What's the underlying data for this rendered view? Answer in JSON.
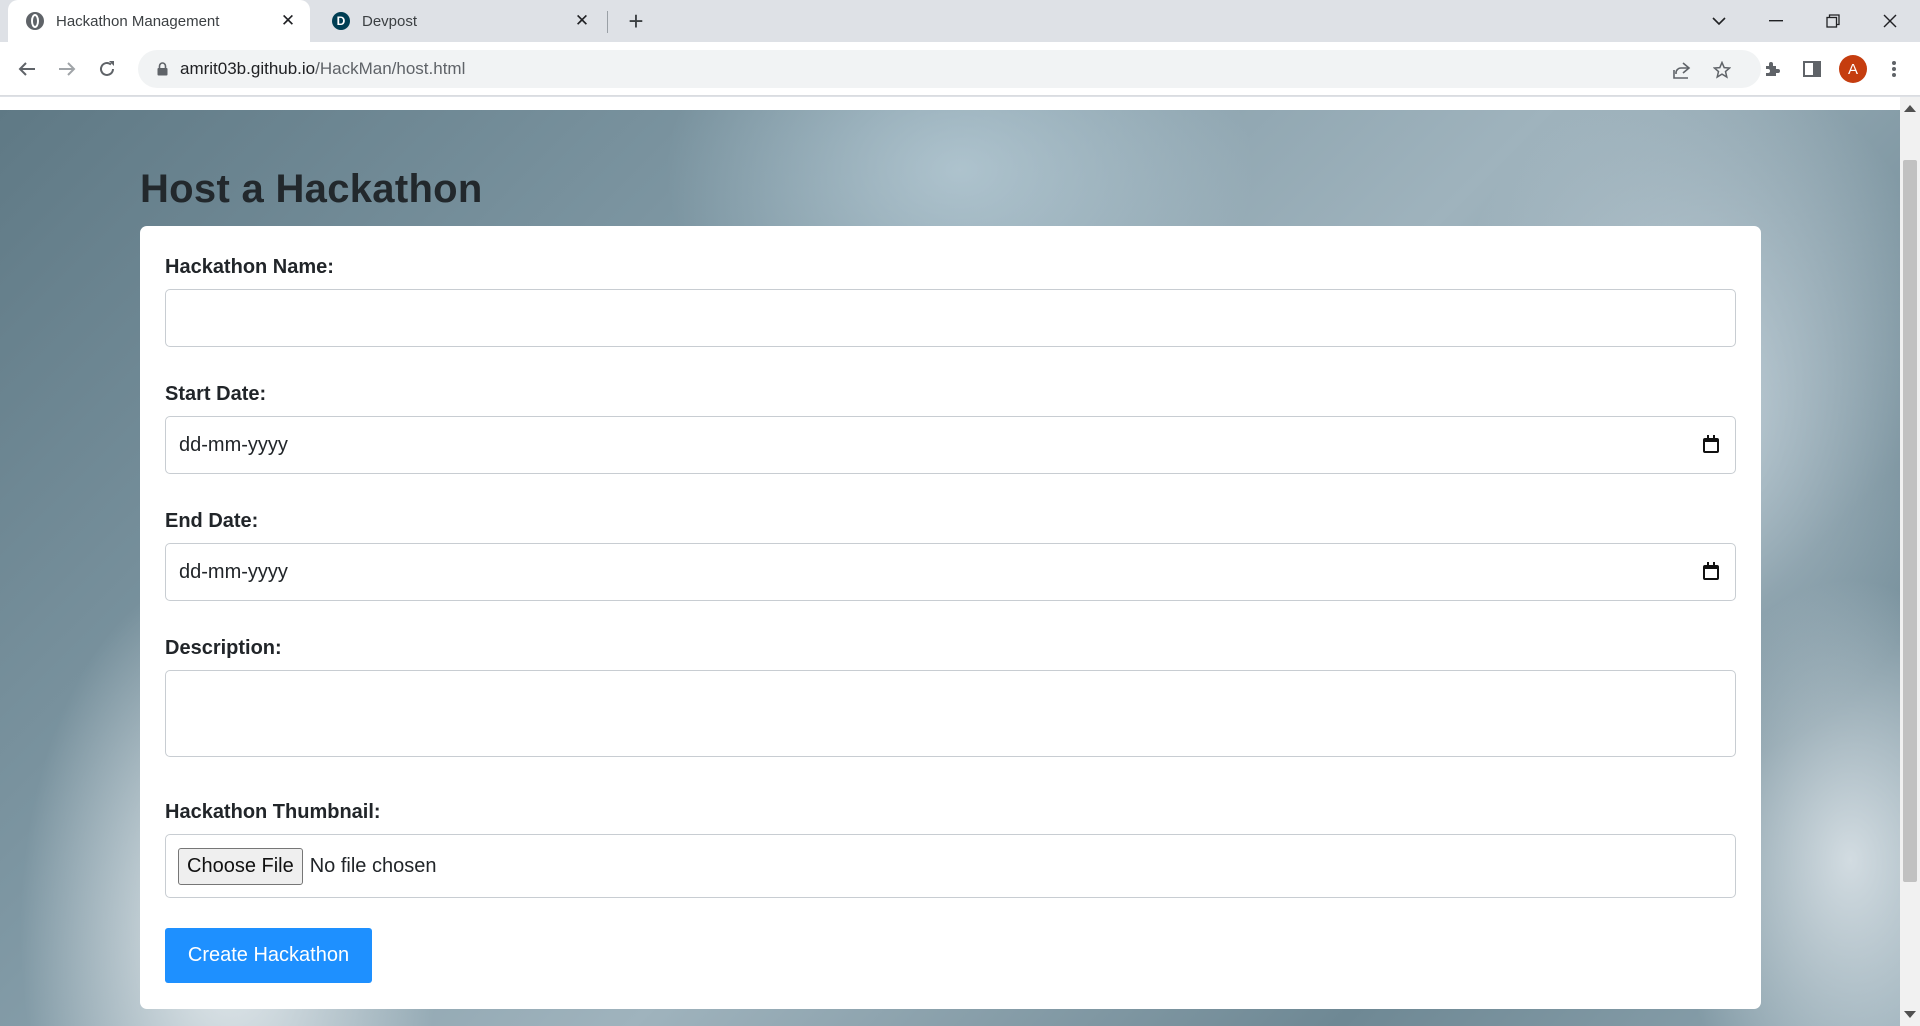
{
  "browser": {
    "tabs": [
      {
        "title": "Hackathon Management",
        "icon": "globe-icon",
        "active": true
      },
      {
        "title": "Devpost",
        "icon": "devpost-d-icon",
        "favicon_letter": "D",
        "active": false
      }
    ],
    "url": {
      "host": "amrit03b.github.io",
      "path": "/HackMan/host.html"
    },
    "profile_initial": "A",
    "accent_color": "#c53d0f"
  },
  "page": {
    "title": "Host a Hackathon",
    "form": {
      "name_label": "Hackathon Name:",
      "name_value": "",
      "start_label": "Start Date:",
      "start_placeholder": "dd-mm-yyyy",
      "end_label": "End Date:",
      "end_placeholder": "dd-mm-yyyy",
      "description_label": "Description:",
      "description_value": "",
      "thumbnail_label": "Hackathon Thumbnail:",
      "choose_file_label": "Choose File",
      "no_file_text": "No file chosen",
      "submit_label": "Create Hackathon",
      "submit_color": "#1e90ff"
    }
  }
}
